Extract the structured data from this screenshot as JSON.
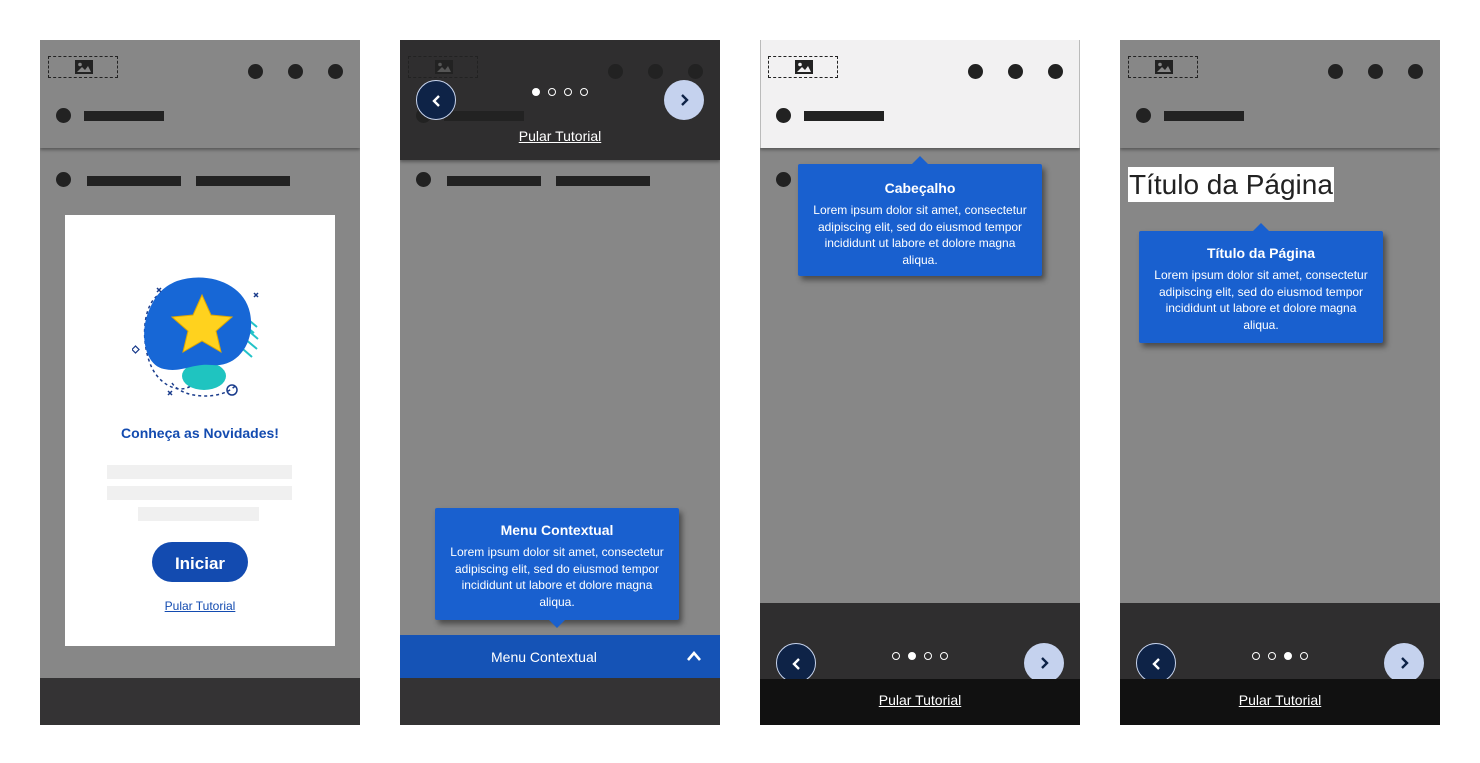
{
  "colors": {
    "accent": "#1960cf",
    "dark_button": "#0e2347",
    "light_button": "#c5d2ee",
    "title_blue": "#134bb0"
  },
  "screen1": {
    "welcome_title": "Conheça as Novidades!",
    "start_button": "Iniciar",
    "skip_link": "Pular Tutorial"
  },
  "screen2": {
    "skip_link": "Pular Tutorial",
    "pager": [
      true,
      false,
      false,
      false
    ],
    "tooltip_title": "Menu Contextual",
    "tooltip_body": "Lorem ipsum dolor sit amet, consectetur adipiscing elit, sed do eiusmod tempor incididunt ut labore et dolore magna aliqua.",
    "context_menu_label": "Menu Contextual"
  },
  "screen3": {
    "tooltip_title": "Cabeçalho",
    "tooltip_body": "Lorem ipsum dolor sit amet, consectetur adipiscing elit, sed do eiusmod tempor incididunt ut labore et dolore magna aliqua.",
    "pager": [
      false,
      true,
      false,
      false
    ],
    "skip_link": "Pular Tutorial"
  },
  "screen4": {
    "page_title": "Título da Página",
    "tooltip_title": "Título da Página",
    "tooltip_body": "Lorem ipsum dolor sit amet, consectetur adipiscing elit, sed do eiusmod tempor incididunt ut labore et dolore magna aliqua.",
    "pager": [
      false,
      false,
      true,
      false
    ],
    "skip_link": "Pular Tutorial"
  }
}
